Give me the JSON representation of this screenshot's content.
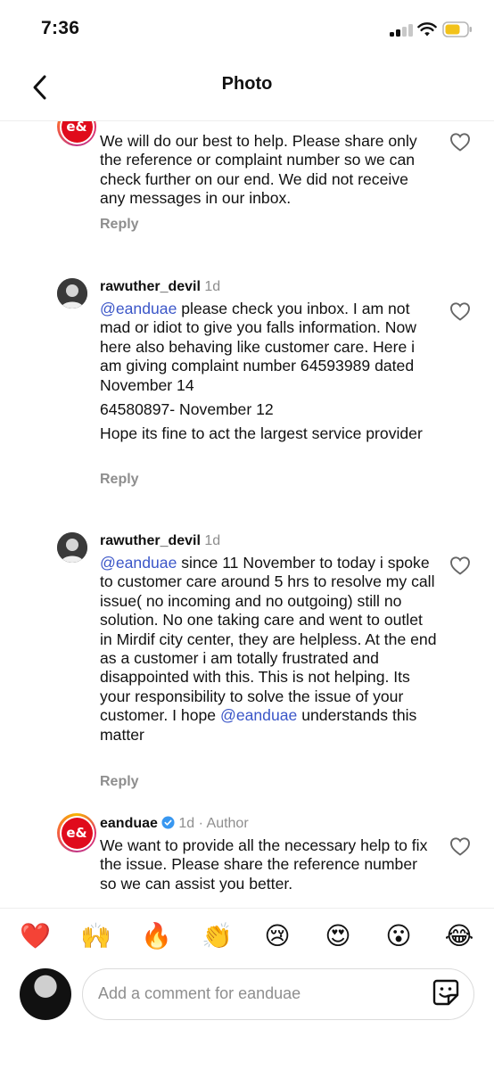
{
  "status_bar": {
    "time": "7:36"
  },
  "header": {
    "title": "Photo"
  },
  "comments": [
    {
      "text": [
        "We will do our best to help. Please share only the reference or complaint number so we can check further on our end. We did not receive any messages in our inbox."
      ],
      "reply_label": "Reply"
    },
    {
      "username": "rawuther_devil",
      "time": "1d",
      "mention": "@eanduae",
      "text": [
        " please check you inbox. I am not mad or idiot to give you falls information. Now here also behaving like customer care. Here i am giving complaint number 64593989 dated November 14",
        "64580897- November 12",
        "Hope its fine to act the largest service provider"
      ],
      "reply_label": "Reply"
    },
    {
      "username": "rawuther_devil",
      "time": "1d",
      "mention": "@eanduae",
      "text": [
        " since 11 November to today i spoke to customer care around 5 hrs to resolve my call issue( no incoming and no outgoing) still no solution. No one taking care and went to outlet in Mirdif city center, they are helpless. At the end as a customer i am totally frustrated and disappointed with this. This is not helping. Its your responsibility to solve the issue of your customer. I hope ",
        " understands this matter"
      ],
      "mention_2": "@eanduae",
      "reply_label": "Reply"
    },
    {
      "username": "eanduae",
      "time": "1d",
      "author_label": "Author",
      "text": [
        "We want to provide all the necessary help to fix the issue. Please share the reference number so we can assist you better."
      ]
    }
  ],
  "reactions": [
    "❤️",
    "🙌",
    "🔥",
    "👏",
    "😢",
    "😍",
    "😮",
    "😂"
  ],
  "composer": {
    "placeholder": "Add a comment for eanduae"
  },
  "colors": {
    "mention": "#3b56c8",
    "verified": "#3897f0",
    "brand_red": "#e00b1c"
  }
}
